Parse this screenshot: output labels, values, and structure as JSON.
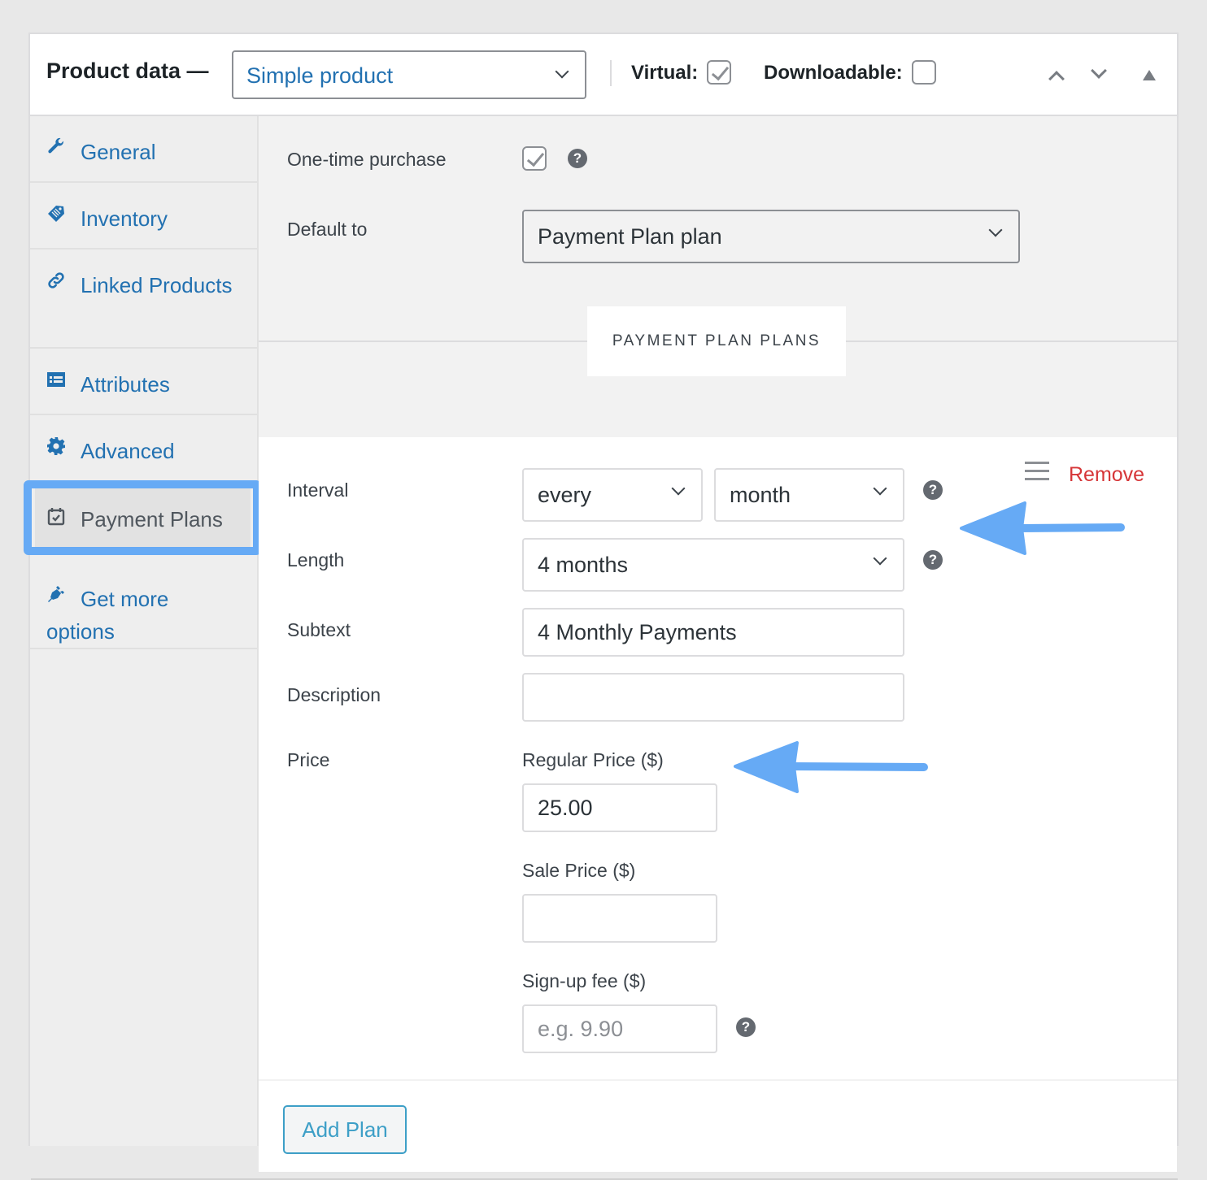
{
  "header": {
    "title": "Product data —",
    "product_type": "Simple product",
    "virtual_label": "Virtual:",
    "virtual_checked": true,
    "downloadable_label": "Downloadable:",
    "downloadable_checked": false
  },
  "sidebar": {
    "items": [
      {
        "label": "General",
        "icon": "wrench-icon"
      },
      {
        "label": "Inventory",
        "icon": "tag-icon"
      },
      {
        "label": "Linked Products",
        "icon": "link-icon"
      },
      {
        "label": "Attributes",
        "icon": "list-icon"
      },
      {
        "label": "Advanced",
        "icon": "gear-icon"
      },
      {
        "label": "Payment Plans",
        "icon": "calendar-check-icon",
        "active": true
      },
      {
        "label": "Get more options",
        "icon": "plug-icon"
      }
    ]
  },
  "main": {
    "one_time_label": "One-time purchase",
    "one_time_checked": true,
    "default_label": "Default to",
    "default_value": "Payment Plan plan",
    "section_title": "PAYMENT PLAN PLANS",
    "plan": {
      "remove_label": "Remove",
      "interval_label": "Interval",
      "interval_every": "every",
      "interval_period": "month",
      "length_label": "Length",
      "length_value": "4 months",
      "subtext_label": "Subtext",
      "subtext_value": "4 Monthly Payments",
      "description_label": "Description",
      "description_value": "",
      "price_label": "Price",
      "regular_price_label": "Regular Price ($)",
      "regular_price_value": "25.00",
      "sale_price_label": "Sale Price ($)",
      "sale_price_value": "",
      "signup_fee_label": "Sign-up fee ($)",
      "signup_fee_placeholder": "e.g. 9.90"
    },
    "add_plan_label": "Add Plan"
  },
  "help_glyph": "?",
  "colors": {
    "link_blue": "#2271b1",
    "remove_red": "#d63638",
    "annotation_blue": "#66aaf5",
    "add_button": "#3d9fc7"
  }
}
